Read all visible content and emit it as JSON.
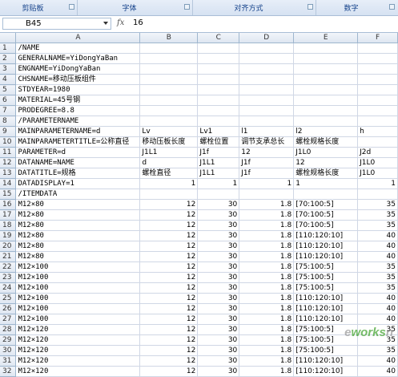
{
  "ribbon": {
    "groups": [
      "剪贴板",
      "字体",
      "对齐方式",
      "数字"
    ]
  },
  "formula_bar": {
    "name_box": "B45",
    "fx": "fx",
    "value": "16"
  },
  "columns": [
    "",
    "A",
    "B",
    "C",
    "D",
    "E",
    "F"
  ],
  "rows": [
    {
      "n": "1",
      "A": "/NAME",
      "B": "",
      "C": "",
      "D": "",
      "E": "",
      "F": ""
    },
    {
      "n": "2",
      "A": "GENERALNAME=YiDongYaBan",
      "B": "",
      "C": "",
      "D": "",
      "E": "",
      "F": ""
    },
    {
      "n": "3",
      "A": "ENGNAME=YiDongYaBan",
      "B": "",
      "C": "",
      "D": "",
      "E": "",
      "F": ""
    },
    {
      "n": "4",
      "A": "CHSNAME=移动压板组件",
      "B": "",
      "C": "",
      "D": "",
      "E": "",
      "F": ""
    },
    {
      "n": "5",
      "A": "STDYEAR=1980",
      "B": "",
      "C": "",
      "D": "",
      "E": "",
      "F": ""
    },
    {
      "n": "6",
      "A": "MATERIAL=45号钢",
      "B": "",
      "C": "",
      "D": "",
      "E": "",
      "F": ""
    },
    {
      "n": "7",
      "A": "PRODEGREE=8.8",
      "B": "",
      "C": "",
      "D": "",
      "E": "",
      "F": ""
    },
    {
      "n": "8",
      "A": "/PARAMETERNAME",
      "B": "",
      "C": "",
      "D": "",
      "E": "",
      "F": ""
    },
    {
      "n": "9",
      "A": "MAINPARAMETERNAME=d",
      "B": "Lv",
      "C": "Lv1",
      "D": "l1",
      "E": "l2",
      "F": "h"
    },
    {
      "n": "10",
      "A": "MAINPARAMETERTITLE=公称直径",
      "B": "移动压板长度",
      "C": "螺栓位置",
      "D": "调节支承总长",
      "E": "螺栓规格长度",
      "F": ""
    },
    {
      "n": "11",
      "A": "PARAMETER=d",
      "B": "J1L1",
      "C": "J1f",
      "D": "12",
      "E": "J1L0",
      "F": "J2d"
    },
    {
      "n": "12",
      "A": "DATANAME=NAME",
      "B": "d",
      "C": "J1L1",
      "D": "J1f",
      "E": "12",
      "F": "J1L0"
    },
    {
      "n": "13",
      "A": "DATATITLE=规格",
      "B": "螺栓直径",
      "C": "J1L1",
      "D": "J1f",
      "E": "螺栓规格长度",
      "F": "J1L0"
    },
    {
      "n": "14",
      "A": "DATADISPLAY=1",
      "B": "1",
      "C": "1",
      "D": "1",
      "E": "1",
      "F": "1"
    },
    {
      "n": "15",
      "A": "/ITEMDATA",
      "B": "",
      "C": "",
      "D": "",
      "E": "",
      "F": ""
    },
    {
      "n": "16",
      "A": "M12×80",
      "B": "12",
      "C": "30",
      "D": "1.8",
      "E": "[70:100:5]",
      "F": "35"
    },
    {
      "n": "17",
      "A": "M12×80",
      "B": "12",
      "C": "30",
      "D": "1.8",
      "E": "[70:100:5]",
      "F": "35"
    },
    {
      "n": "18",
      "A": "M12×80",
      "B": "12",
      "C": "30",
      "D": "1.8",
      "E": "[70:100:5]",
      "F": "35"
    },
    {
      "n": "19",
      "A": "M12×80",
      "B": "12",
      "C": "30",
      "D": "1.8",
      "E": "[110:120:10]",
      "F": "40"
    },
    {
      "n": "20",
      "A": "M12×80",
      "B": "12",
      "C": "30",
      "D": "1.8",
      "E": "[110:120:10]",
      "F": "40"
    },
    {
      "n": "21",
      "A": "M12×80",
      "B": "12",
      "C": "30",
      "D": "1.8",
      "E": "[110:120:10]",
      "F": "40"
    },
    {
      "n": "22",
      "A": "M12×100",
      "B": "12",
      "C": "30",
      "D": "1.8",
      "E": "[75:100:5]",
      "F": "35"
    },
    {
      "n": "23",
      "A": "M12×100",
      "B": "12",
      "C": "30",
      "D": "1.8",
      "E": "[75:100:5]",
      "F": "35"
    },
    {
      "n": "24",
      "A": "M12×100",
      "B": "12",
      "C": "30",
      "D": "1.8",
      "E": "[75:100:5]",
      "F": "35"
    },
    {
      "n": "25",
      "A": "M12×100",
      "B": "12",
      "C": "30",
      "D": "1.8",
      "E": "[110:120:10]",
      "F": "40"
    },
    {
      "n": "26",
      "A": "M12×100",
      "B": "12",
      "C": "30",
      "D": "1.8",
      "E": "[110:120:10]",
      "F": "40"
    },
    {
      "n": "27",
      "A": "M12×100",
      "B": "12",
      "C": "30",
      "D": "1.8",
      "E": "[110:120:10]",
      "F": "40"
    },
    {
      "n": "28",
      "A": "M12×120",
      "B": "12",
      "C": "30",
      "D": "1.8",
      "E": "[75:100:5]",
      "F": "35"
    },
    {
      "n": "29",
      "A": "M12×120",
      "B": "12",
      "C": "30",
      "D": "1.8",
      "E": "[75:100:5]",
      "F": "35"
    },
    {
      "n": "30",
      "A": "M12×120",
      "B": "12",
      "C": "30",
      "D": "1.8",
      "E": "[75:100:5]",
      "F": "35"
    },
    {
      "n": "31",
      "A": "M12×120",
      "B": "12",
      "C": "30",
      "D": "1.8",
      "E": "[110:120:10]",
      "F": "40"
    },
    {
      "n": "32",
      "A": "M12×120",
      "B": "12",
      "C": "30",
      "D": "1.8",
      "E": "[110:120:10]",
      "F": "40"
    }
  ],
  "watermark": {
    "text1": "e",
    "text2": "works",
    "text3": "n"
  }
}
